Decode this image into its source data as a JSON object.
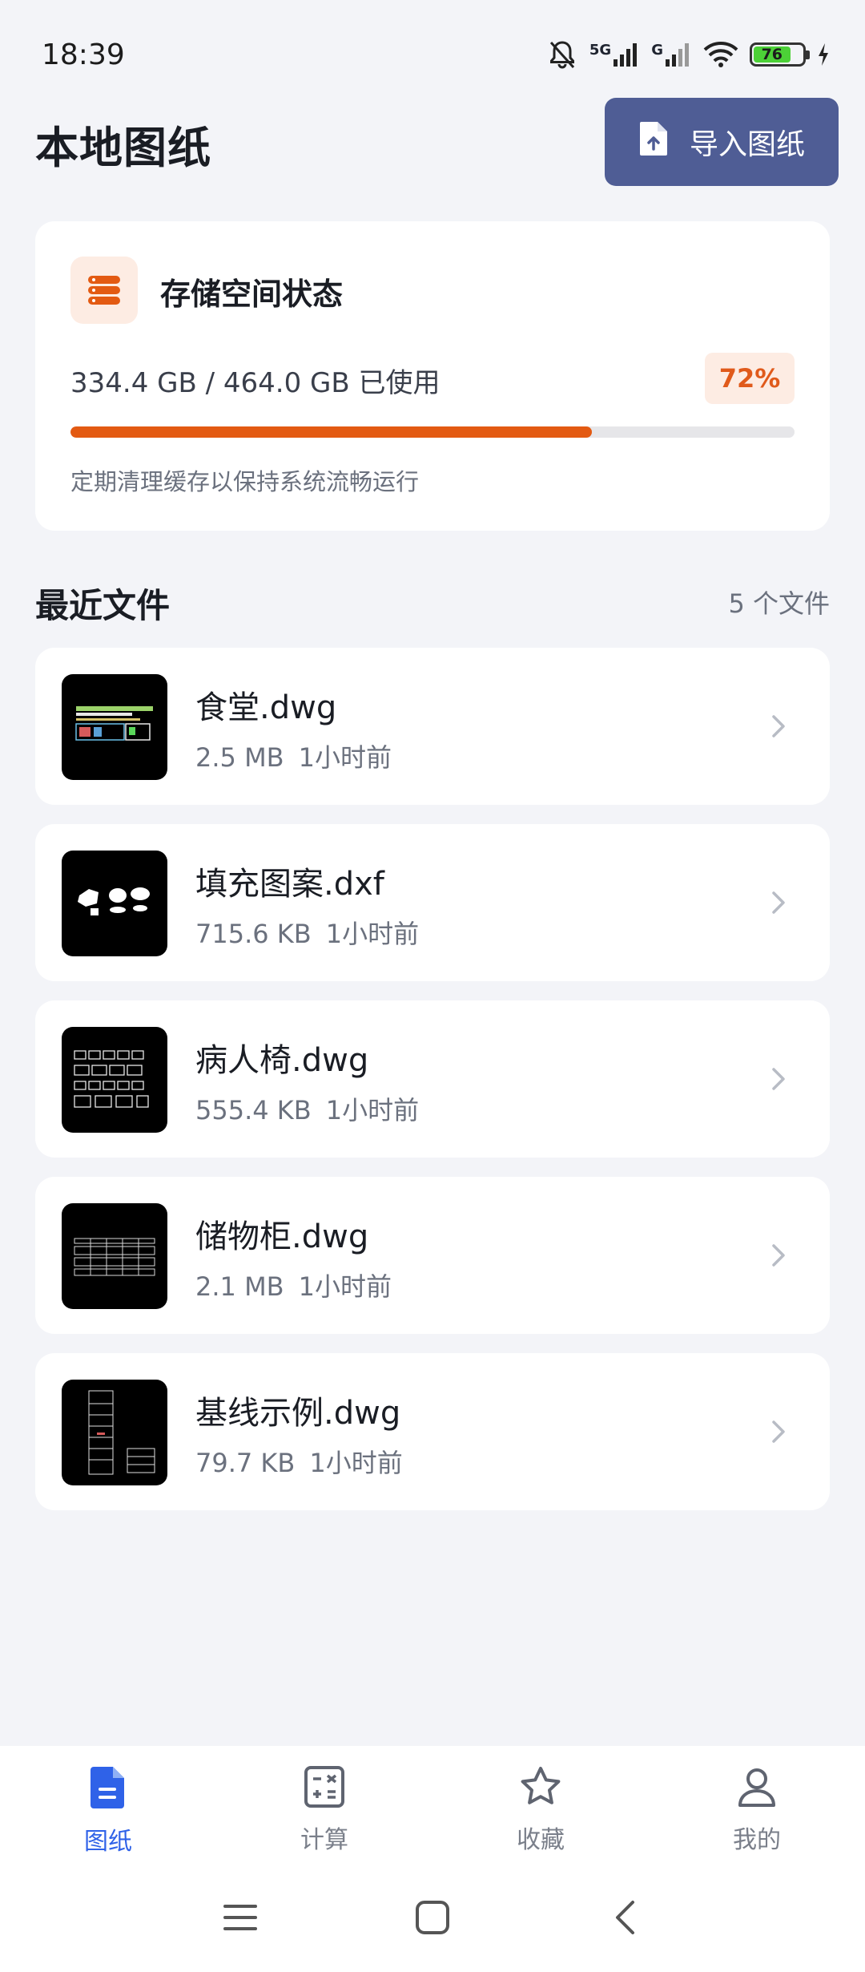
{
  "status_bar": {
    "time": "18:39",
    "signal_1_label": "5G",
    "signal_2_label": "G",
    "battery_level": "76",
    "battery_fraction": 0.76
  },
  "header": {
    "title": "本地图纸",
    "import_label": "导入图纸"
  },
  "storage": {
    "title": "存储空间状态",
    "usage_text": "334.4 GB / 464.0 GB 已使用",
    "percent_text": "72%",
    "fraction": 0.72,
    "tip": "定期清理缓存以保持系统流畅运行",
    "accent_color": "#e35a12"
  },
  "recent": {
    "title": "最近文件",
    "count_text": "5 个文件",
    "files": [
      {
        "name": "食堂.dwg",
        "size": "2.5 MB",
        "time": "1小时前"
      },
      {
        "name": "填充图案.dxf",
        "size": "715.6 KB",
        "time": "1小时前"
      },
      {
        "name": "病人椅.dwg",
        "size": "555.4 KB",
        "time": "1小时前"
      },
      {
        "name": "储物柜.dwg",
        "size": "2.1 MB",
        "time": "1小时前"
      },
      {
        "name": "基线示例.dwg",
        "size": "79.7 KB",
        "time": "1小时前"
      }
    ]
  },
  "bottom_nav": {
    "items": [
      {
        "label": "图纸",
        "icon": "document-icon",
        "active": true
      },
      {
        "label": "计算",
        "icon": "calculator-icon",
        "active": false
      },
      {
        "label": "收藏",
        "icon": "star-icon",
        "active": false
      },
      {
        "label": "我的",
        "icon": "user-icon",
        "active": false
      }
    ],
    "active_color": "#2f62e8"
  }
}
